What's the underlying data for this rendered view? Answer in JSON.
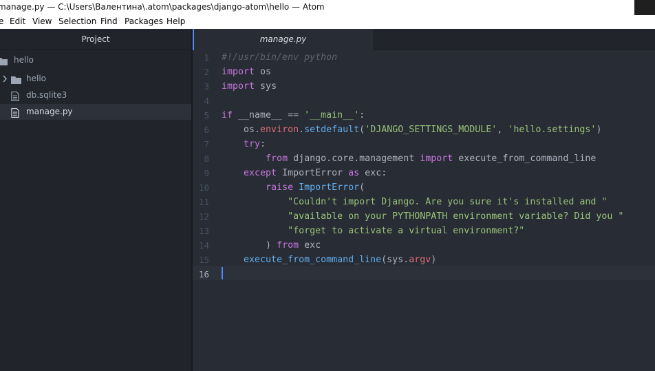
{
  "window": {
    "title": "manage.py — C:\\Users\\Валентина\\.atom\\packages\\django-atom\\hello — Atom"
  },
  "menu": {
    "items": [
      "e",
      "Edit",
      "View",
      "Selection",
      "Find",
      "Packages",
      "Help"
    ]
  },
  "sidebar": {
    "header": "Project",
    "root": "hello",
    "items": [
      {
        "label": "hello",
        "type": "folder",
        "icon": "folder-icon"
      },
      {
        "label": "db.sqlite3",
        "type": "file",
        "icon": "file-icon"
      },
      {
        "label": "manage.py",
        "type": "file",
        "icon": "file-icon",
        "selected": true
      }
    ]
  },
  "tabs": [
    {
      "label": "manage.py",
      "active": true
    }
  ],
  "editor": {
    "line_numbers": [
      "1",
      "2",
      "3",
      "4",
      "5",
      "6",
      "7",
      "8",
      "9",
      "10",
      "11",
      "12",
      "13",
      "14",
      "15",
      "16"
    ],
    "current_line": 16,
    "lines": [
      [
        {
          "t": "#!/usr/bin/env python",
          "c": "cm"
        }
      ],
      [
        {
          "t": "import",
          "c": "kw"
        },
        {
          "t": " os",
          "c": ""
        }
      ],
      [
        {
          "t": "import",
          "c": "kw"
        },
        {
          "t": " sys",
          "c": ""
        }
      ],
      [],
      [
        {
          "t": "if",
          "c": "kw"
        },
        {
          "t": " __name__ == ",
          "c": ""
        },
        {
          "t": "'__main__'",
          "c": "str"
        },
        {
          "t": ":",
          "c": ""
        }
      ],
      [
        {
          "t": "    os.",
          "c": ""
        },
        {
          "t": "environ",
          "c": "attr"
        },
        {
          "t": ".",
          "c": ""
        },
        {
          "t": "setdefault",
          "c": "fn"
        },
        {
          "t": "(",
          "c": ""
        },
        {
          "t": "'DJANGO_SETTINGS_MODULE'",
          "c": "str"
        },
        {
          "t": ", ",
          "c": ""
        },
        {
          "t": "'hello.settings'",
          "c": "str"
        },
        {
          "t": ")",
          "c": ""
        }
      ],
      [
        {
          "t": "    ",
          "c": ""
        },
        {
          "t": "try",
          "c": "kw"
        },
        {
          "t": ":",
          "c": ""
        }
      ],
      [
        {
          "t": "        ",
          "c": ""
        },
        {
          "t": "from",
          "c": "kw"
        },
        {
          "t": " django.core.management ",
          "c": ""
        },
        {
          "t": "import",
          "c": "kw"
        },
        {
          "t": " execute_from_command_line",
          "c": ""
        }
      ],
      [
        {
          "t": "    ",
          "c": ""
        },
        {
          "t": "except",
          "c": "kw"
        },
        {
          "t": " ImportError ",
          "c": ""
        },
        {
          "t": "as",
          "c": "kw"
        },
        {
          "t": " exc:",
          "c": ""
        }
      ],
      [
        {
          "t": "        ",
          "c": ""
        },
        {
          "t": "raise",
          "c": "kw"
        },
        {
          "t": " ",
          "c": ""
        },
        {
          "t": "ImportError",
          "c": "fn"
        },
        {
          "t": "(",
          "c": ""
        }
      ],
      [
        {
          "t": "            ",
          "c": ""
        },
        {
          "t": "\"Couldn't import Django. Are you sure it's installed and \"",
          "c": "str"
        }
      ],
      [
        {
          "t": "            ",
          "c": ""
        },
        {
          "t": "\"available on your PYTHONPATH environment variable? Did you \"",
          "c": "str"
        }
      ],
      [
        {
          "t": "            ",
          "c": ""
        },
        {
          "t": "\"forget to activate a virtual environment?\"",
          "c": "str"
        }
      ],
      [
        {
          "t": "        ) ",
          "c": ""
        },
        {
          "t": "from",
          "c": "kw"
        },
        {
          "t": " exc",
          "c": ""
        }
      ],
      [
        {
          "t": "    ",
          "c": ""
        },
        {
          "t": "execute_from_command_line",
          "c": "fn"
        },
        {
          "t": "(sys.",
          "c": ""
        },
        {
          "t": "argv",
          "c": "attr"
        },
        {
          "t": ")",
          "c": ""
        }
      ],
      []
    ]
  },
  "colors": {
    "background": "#282c34",
    "sidebar": "#21252b",
    "keyword": "#c678dd",
    "string": "#98c379",
    "function": "#61afef",
    "attribute": "#e06c75",
    "comment": "#5c6370",
    "accent": "#568af2"
  }
}
